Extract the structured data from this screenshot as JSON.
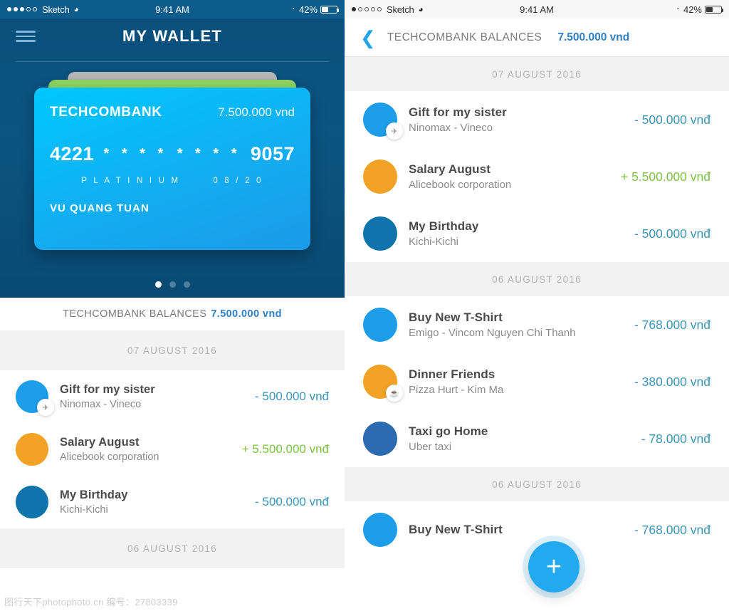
{
  "left_screen": {
    "status_bar": {
      "carrier": "Sketch",
      "signal_filled": 3,
      "signal_total": 5,
      "wifi_icon": "wifi-icon",
      "time": "9:41 AM",
      "bluetooth_icon": "bluetooth-icon",
      "battery_percent": "42%"
    },
    "nav": {
      "menu_icon": "hamburger-menu-icon",
      "title": "MY WALLET"
    },
    "card": {
      "bank": "TECHCOMBANK",
      "balance": "7.500.000 vnd",
      "number_first": "4221",
      "masked_a": "* * * *",
      "masked_b": "* * * *",
      "number_last": "9057",
      "tier": "P L A T I N I U M",
      "expiry": "0 8 / 2 0",
      "holder": "VU QUANG TUAN",
      "front_color": "#12aef2",
      "mid_color": "#8ed45f",
      "back_color": "#b5b5b5"
    },
    "pager": {
      "total": 3,
      "active_index": 0
    },
    "balance_bar": {
      "label": "TECHCOMBANK BALANCES",
      "amount": "7.500.000 vnd"
    },
    "groups": [
      {
        "date": "07 AUGUST 2016",
        "transactions": [
          {
            "title": "Gift for my sister",
            "subtitle": "Ninomax - Vineco",
            "amount": "- 500.000 vnđ",
            "sign": "neg",
            "avatar_color": "#1e9ee8",
            "badge_icon": "airplane-icon"
          },
          {
            "title": "Salary August",
            "subtitle": "Alicebook corporation",
            "amount": "+ 5.500.000 vnđ",
            "sign": "pos",
            "avatar_color": "#f2a224",
            "badge_icon": ""
          },
          {
            "title": "My Birthday",
            "subtitle": "Kichi-Kichi",
            "amount": "- 500.000 vnđ",
            "sign": "neg",
            "avatar_color": "#0e74ab",
            "badge_icon": ""
          }
        ]
      },
      {
        "date": "06 AUGUST 2016",
        "transactions": []
      }
    ]
  },
  "right_screen": {
    "status_bar": {
      "carrier": "Sketch",
      "signal_filled": 1,
      "signal_total": 5,
      "wifi_icon": "wifi-icon",
      "time": "9:41 AM",
      "bluetooth_icon": "bluetooth-icon",
      "battery_percent": "42%"
    },
    "nav": {
      "back_icon": "chevron-left-icon",
      "label": "TECHCOMBANK BALANCES",
      "amount": "7.500.000 vnd"
    },
    "groups": [
      {
        "date": "07 AUGUST 2016",
        "transactions": [
          {
            "title": "Gift for my sister",
            "subtitle": "Ninomax - Vineco",
            "amount": "- 500.000 vnđ",
            "sign": "neg",
            "avatar_color": "#1e9ee8",
            "badge_icon": "airplane-icon"
          },
          {
            "title": "Salary August",
            "subtitle": "Alicebook corporation",
            "amount": "+ 5.500.000 vnđ",
            "sign": "pos",
            "avatar_color": "#f2a224",
            "badge_icon": ""
          },
          {
            "title": "My Birthday",
            "subtitle": "Kichi-Kichi",
            "amount": "- 500.000 vnđ",
            "sign": "neg",
            "avatar_color": "#0e74ab",
            "badge_icon": ""
          }
        ]
      },
      {
        "date": "06 AUGUST 2016",
        "transactions": [
          {
            "title": "Buy New T-Shirt",
            "subtitle": "Emigo - Vincom Nguyen Chi Thanh",
            "amount": "- 768.000 vnđ",
            "sign": "neg",
            "avatar_color": "#1e9ee8",
            "badge_icon": ""
          },
          {
            "title": "Dinner Friends",
            "subtitle": "Pizza Hurt - Kim Ma",
            "amount": "- 380.000 vnđ",
            "sign": "neg",
            "avatar_color": "#f2a224",
            "badge_icon": "coffee-cup-icon"
          },
          {
            "title": "Taxi go Home",
            "subtitle": "Uber taxi",
            "amount": "- 78.000 vnđ",
            "sign": "neg",
            "avatar_color": "#2d6bb0",
            "badge_icon": ""
          }
        ]
      },
      {
        "date": "06 AUGUST 2016",
        "transactions": [
          {
            "title": "Buy New T-Shirt",
            "subtitle": "",
            "amount": "- 768.000 vnđ",
            "sign": "neg",
            "avatar_color": "#1e9ee8",
            "badge_icon": ""
          }
        ]
      }
    ],
    "fab": {
      "icon": "plus-icon",
      "label": "+",
      "color": "#22a9f0"
    }
  },
  "watermark": "图行天下photophoto.cn 编号：27803339"
}
